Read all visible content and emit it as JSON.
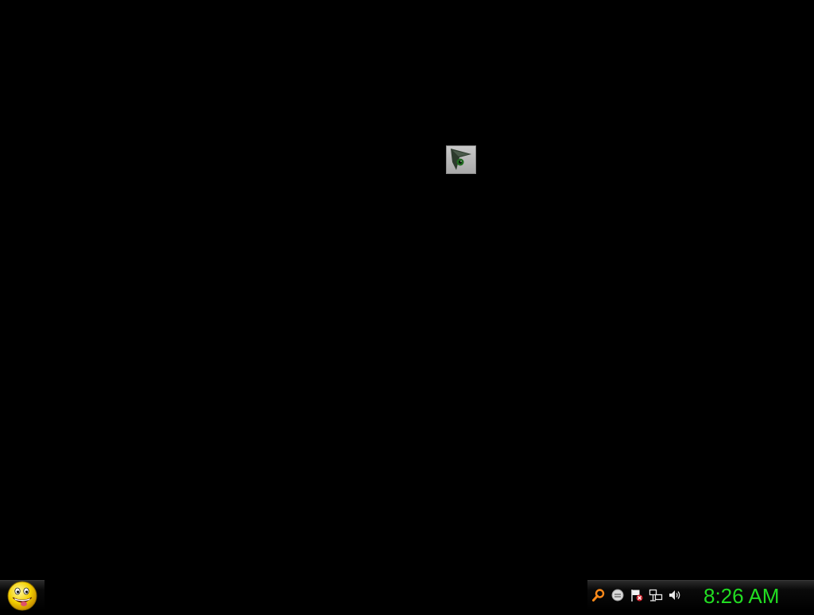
{
  "desktop": {
    "background_color": "#000000",
    "icons": [
      {
        "name": "eye-shortcut",
        "icon": "eye-icon"
      }
    ]
  },
  "taskbar": {
    "start_button": {
      "icon": "smiley-face-icon"
    },
    "tray": {
      "icons": [
        "search-icon",
        "messenger-icon",
        "flag-alert-icon",
        "network-icon",
        "volume-icon"
      ],
      "clock": "8:26 AM",
      "clock_color": "#22dd22"
    }
  }
}
